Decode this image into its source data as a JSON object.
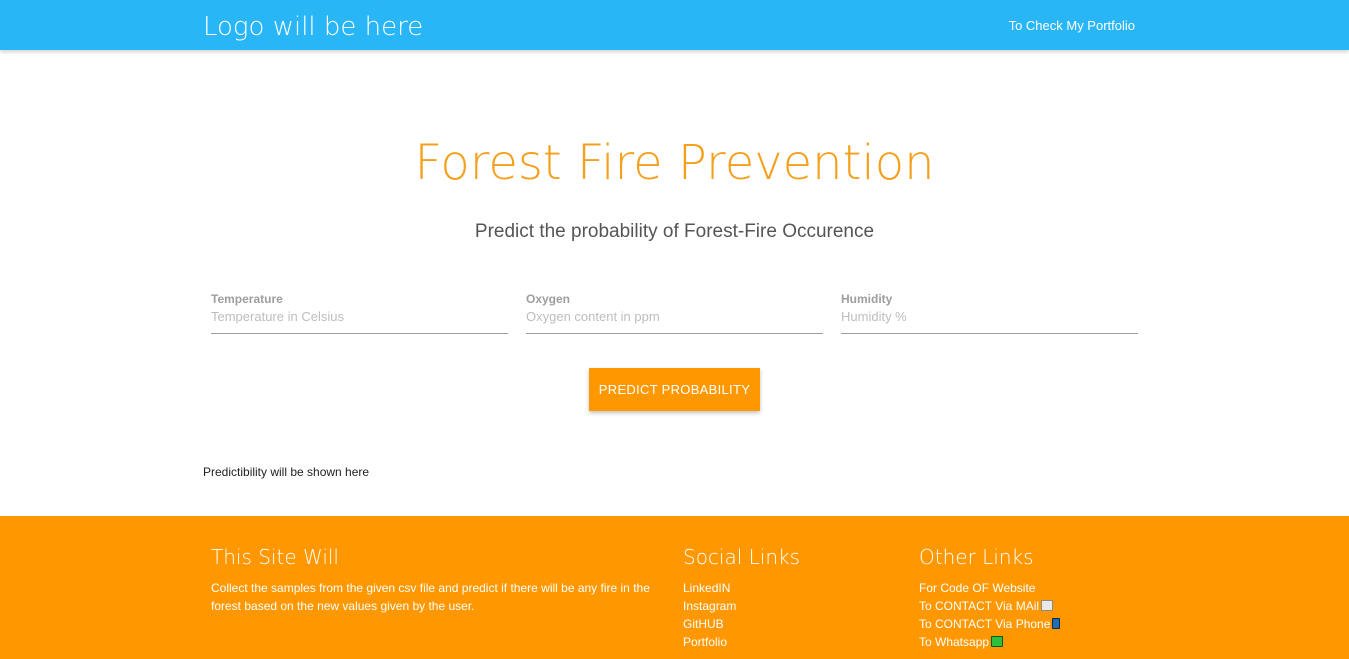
{
  "navbar": {
    "brand": "Logo will be here",
    "link": "To Check My Portfolio"
  },
  "hero": {
    "title": "Forest Fire Prevention",
    "subtitle": "Predict the probability of Forest-Fire Occurence"
  },
  "form": {
    "fields": [
      {
        "label": "Temperature",
        "placeholder": "Temperature in Celsius",
        "value": ""
      },
      {
        "label": "Oxygen",
        "placeholder": "Oxygen content in ppm",
        "value": ""
      },
      {
        "label": "Humidity",
        "placeholder": "Humidity %",
        "value": ""
      }
    ],
    "button": "PREDICT PROBABILITY"
  },
  "result": "Predictibility will be shown here",
  "footer": {
    "about": {
      "title": "This Site Will",
      "text": "Collect the samples from the given csv file and predict if there will be any fire in the forest based on the new values given by the user."
    },
    "social": {
      "title": "Social Links",
      "links": [
        "LinkedIN",
        "Instagram",
        "GitHUB",
        "Portfolio"
      ]
    },
    "other": {
      "title": "Other Links",
      "links": [
        {
          "label": "For Code OF Website",
          "icon": ""
        },
        {
          "label": "To CONTACT Via MAil",
          "icon": "envelope-icon"
        },
        {
          "label": "To CONTACT Via Phone",
          "icon": "phone-icon"
        },
        {
          "label": "To Whatsapp",
          "icon": "whatsapp-icon"
        }
      ]
    }
  },
  "colors": {
    "navbar": "#29b6f6",
    "accent": "#ff9800",
    "title": "#f5a01c"
  }
}
